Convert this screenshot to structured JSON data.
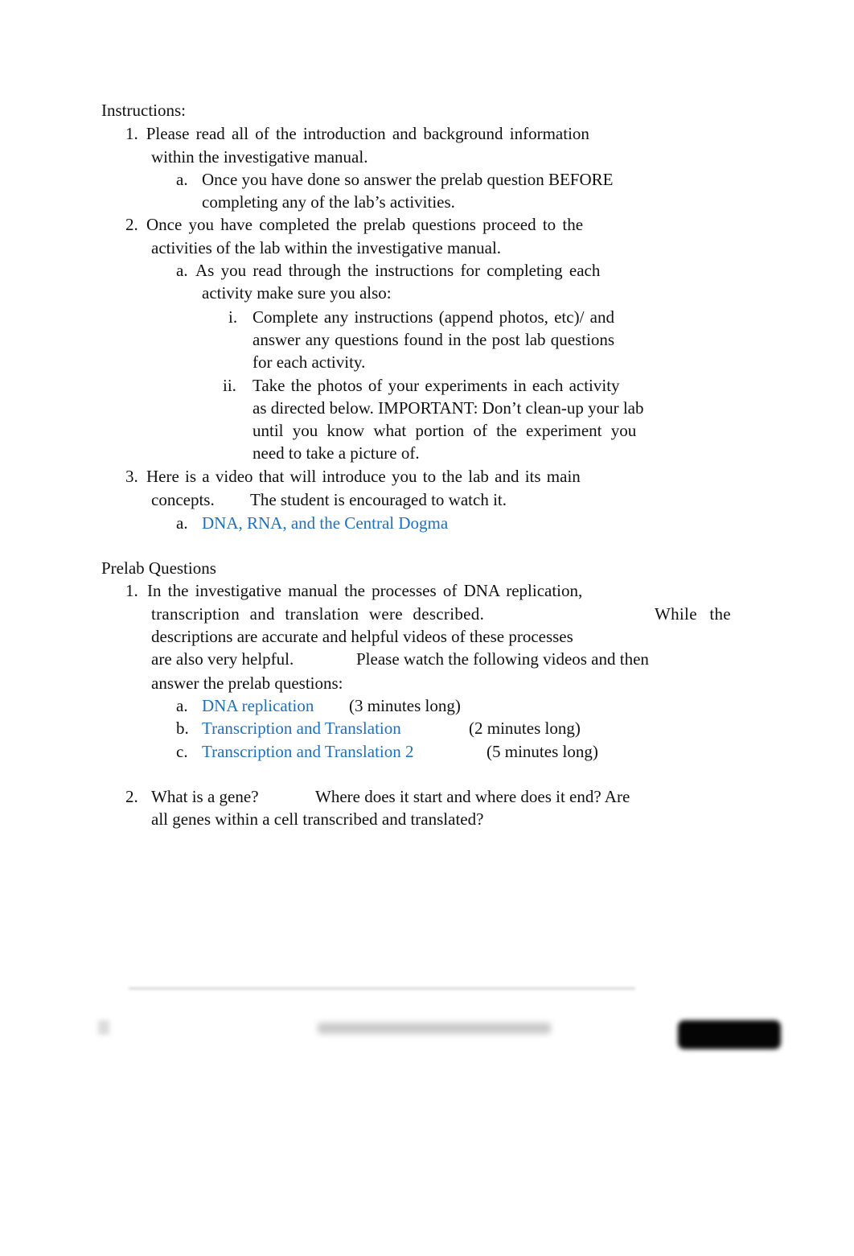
{
  "instructions": {
    "heading": "Instructions:",
    "item1": {
      "num": "1.",
      "line1": "Please read all of the introduction and background information",
      "line2": "within the investigative manual.",
      "a": {
        "label": "a.",
        "line1": "Once you have done so answer the prelab question BEFORE",
        "line2": "completing any of the lab’s activities."
      }
    },
    "item2": {
      "num": "2.",
      "line1": "Once you have completed the prelab questions proceed to the",
      "line2": "activities of the lab within the investigative manual.",
      "a": {
        "label": "a.",
        "line1": "As you read through the instructions for completing each",
        "line2": "activity make sure you also:",
        "i": {
          "label": "i.",
          "line1": "Complete any instructions (append photos, etc)/ and",
          "line2": "answer any questions found in the post lab questions",
          "line3": "for each activity."
        },
        "ii": {
          "label": "ii.",
          "line1": "Take the photos of your experiments in each activity",
          "line2": "as directed below. IMPORTANT: Don’t clean-up your lab",
          "line3": "until you know what portion of the experiment you",
          "line4": "need to take a picture of."
        }
      }
    },
    "item3": {
      "num": "3.",
      "line1": "Here is a video that will introduce you to the lab and its main",
      "line2a": "concepts.",
      "line2b": "The student is encouraged to watch it.",
      "a": {
        "label": "a.",
        "link": "DNA, RNA, and the Central Dogma"
      }
    }
  },
  "prelab": {
    "heading": "Prelab Questions",
    "q1": {
      "num": "1.",
      "line1": "In the investigative manual the processes of DNA replication,",
      "line2a": "transcription and translation were described.",
      "line2b": "While the",
      "line3": "descriptions are accurate and helpful videos of these processes",
      "line4a": "are also very helpful.",
      "line4b": "Please watch the following videos and then",
      "line5": "answer the prelab questions:",
      "videos": [
        {
          "label": "a.",
          "link": "DNA replication",
          "duration": "(3 minutes long)"
        },
        {
          "label": "b.",
          "link": "Transcription and Translation",
          "duration": "(2 minutes long)"
        },
        {
          "label": "c.",
          "link": "Transcription and Translation 2",
          "duration": "(5 minutes long)"
        }
      ]
    },
    "q2": {
      "num": "2.",
      "line1a": "What is a gene?",
      "line1b": "Where does it start and where does it end? Are",
      "line2": "all genes within a cell transcribed and translated?"
    }
  },
  "colors": {
    "link": "#1f6fbf",
    "text": "#111111"
  }
}
